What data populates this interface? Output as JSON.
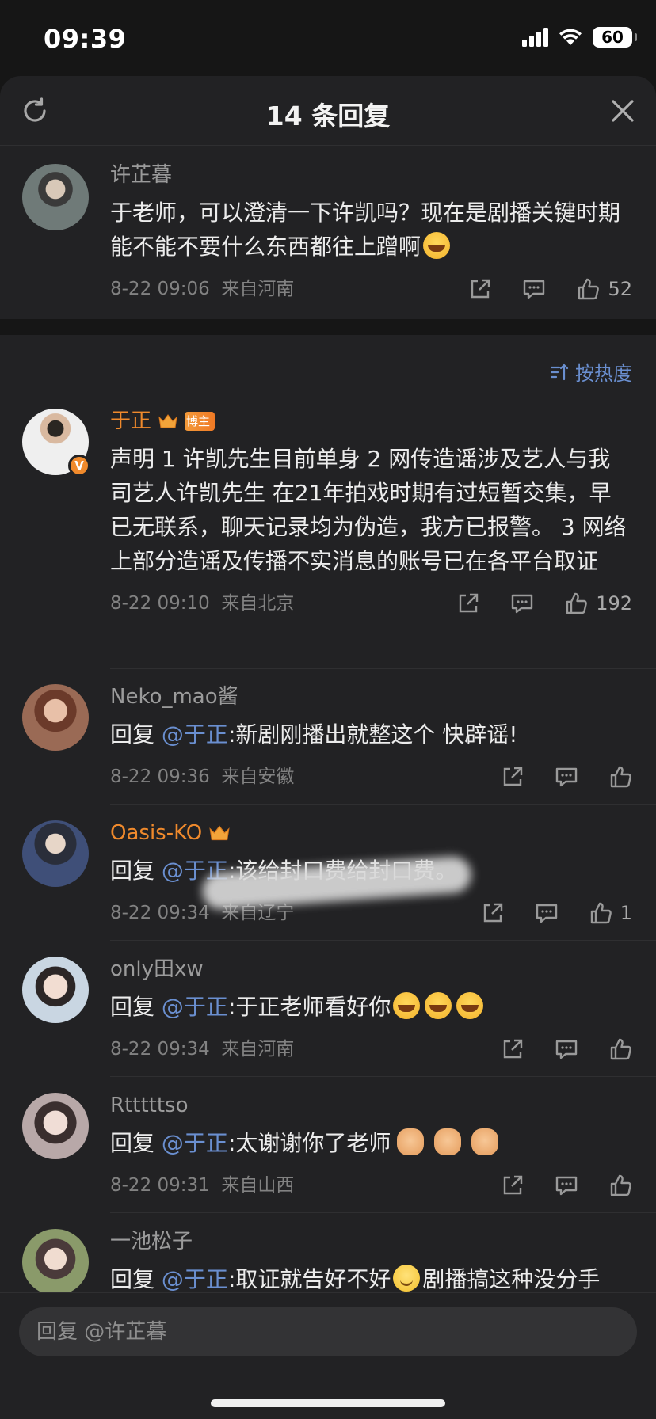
{
  "status_bar": {
    "time": "09:39",
    "battery": "60"
  },
  "header": {
    "title": "14 条回复"
  },
  "root_comment": {
    "name": "许芷暮",
    "text": "于老师，可以澄清一下许凯吗？现在是剧播关键时期能不能不要什么东西都往上蹭啊",
    "time": "8-22 09:06",
    "location": "来自河南",
    "likes": "52"
  },
  "sort_label": "按热度",
  "replies": [
    {
      "name": "于正",
      "badge": "博主",
      "text": "声明 1 许凯先生目前单身 2 网传造谣涉及艺人与我司艺人许凯先生 在21年拍戏时期有过短暂交集，早已无联系，聊天记录均为伪造，我方已报警。 3 网络上部分造谣及传播不实消息的账号已在各平台取证",
      "time": "8-22 09:10",
      "location": "来自北京",
      "likes": "192"
    },
    {
      "name": "Neko_mao酱",
      "reply_prefix": "回复",
      "mention": "@于正",
      "text": ":新剧刚播出就整这个 快辟谣!",
      "time": "8-22 09:36",
      "location": "来自安徽",
      "likes": ""
    },
    {
      "name": "Oasis-KO",
      "reply_prefix": "回复",
      "mention": "@于正",
      "text": ":该给封口费给封口费。",
      "time": "8-22 09:34",
      "location": "来自辽宁",
      "likes": "1"
    },
    {
      "name": "only田xw",
      "reply_prefix": "回复",
      "mention": "@于正",
      "text": ":于正老师看好你",
      "time": "8-22 09:34",
      "location": "来自河南",
      "likes": ""
    },
    {
      "name": "Rtttttso",
      "reply_prefix": "回复",
      "mention": "@于正",
      "text": ":太谢谢你了老师",
      "time": "8-22 09:31",
      "location": "来自山西",
      "likes": ""
    },
    {
      "name": "一池松子",
      "reply_prefix": "回复",
      "mention": "@于正",
      "text": ":取证就告好不好",
      "text_after": "剧播搞这种没分手",
      "time": "",
      "location": "",
      "likes": ""
    }
  ],
  "reply_bar": {
    "placeholder": "回复 @许芷暮"
  },
  "colors": {
    "accent_orange": "#f08a2c",
    "mention_blue": "#6a8fd0",
    "background": "#222224"
  },
  "icons": [
    "refresh-icon",
    "close-icon",
    "share-icon",
    "comment-icon",
    "like-icon",
    "crown-icon",
    "verified-icon",
    "sort-icon"
  ]
}
